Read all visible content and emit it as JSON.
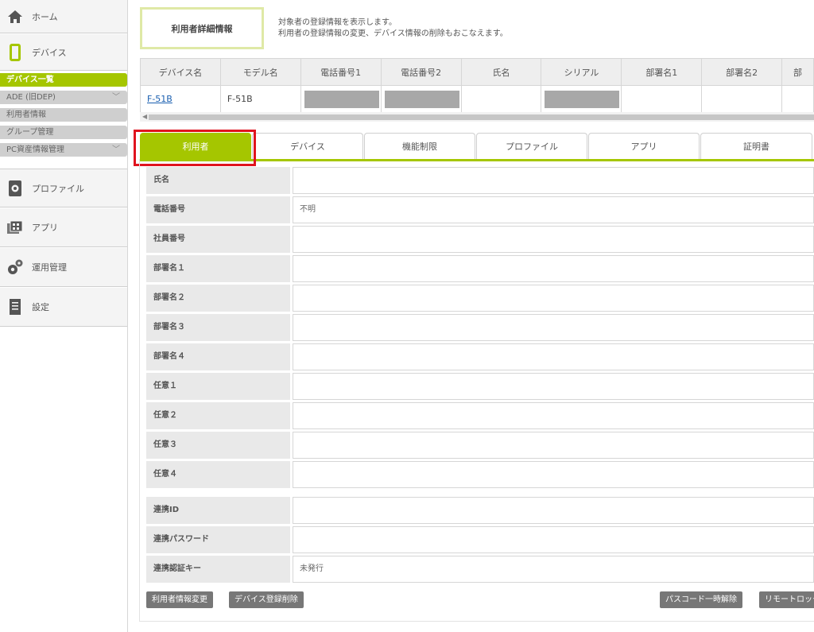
{
  "sidebar": {
    "home_label": "ホーム",
    "device_label": "デバイス",
    "sub_items": [
      {
        "label": "デバイス一覧",
        "active": true,
        "has_chevron": false
      },
      {
        "label": "ADE (旧DEP)",
        "active": false,
        "has_chevron": true
      },
      {
        "label": "利用者情報",
        "active": false,
        "has_chevron": false
      },
      {
        "label": "グループ管理",
        "active": false,
        "has_chevron": false
      },
      {
        "label": "PC資産情報管理",
        "active": false,
        "has_chevron": true
      }
    ],
    "profile_label": "プロファイル",
    "app_label": "アプリ",
    "ops_label": "運用管理",
    "settings_label": "設定"
  },
  "header": {
    "title": "利用者詳細情報",
    "desc_line1": "対象者の登録情報を表示します。",
    "desc_line2": "利用者の登録情報の変更、デバイス情報の削除もおこなえます。"
  },
  "device_table": {
    "columns": [
      "デバイス名",
      "モデル名",
      "電話番号1",
      "電話番号2",
      "氏名",
      "シリアル",
      "部署名1",
      "部署名2",
      "部"
    ],
    "row": {
      "device_name": "F-51B",
      "model_name": "F-51B",
      "masked_cells": [
        "電話番号1",
        "電話番号2",
        "シリアル"
      ]
    }
  },
  "tabs": [
    {
      "label": "利用者",
      "active": true
    },
    {
      "label": "デバイス",
      "active": false
    },
    {
      "label": "機能制限",
      "active": false
    },
    {
      "label": "プロファイル",
      "active": false
    },
    {
      "label": "アプリ",
      "active": false
    },
    {
      "label": "証明書",
      "active": false
    }
  ],
  "form": {
    "rows": [
      {
        "label": "氏名",
        "value": ""
      },
      {
        "label": "電話番号",
        "value": "不明"
      },
      {
        "label": "社員番号",
        "value": ""
      },
      {
        "label": "部署名１",
        "value": ""
      },
      {
        "label": "部署名２",
        "value": ""
      },
      {
        "label": "部署名３",
        "value": ""
      },
      {
        "label": "部署名４",
        "value": ""
      },
      {
        "label": "任意１",
        "value": ""
      },
      {
        "label": "任意２",
        "value": ""
      },
      {
        "label": "任意３",
        "value": ""
      },
      {
        "label": "任意４",
        "value": ""
      },
      {
        "label": "連携ID",
        "value": ""
      },
      {
        "label": "連携パスワード",
        "value": ""
      },
      {
        "label": "連携認証キー",
        "value": "未発行"
      }
    ]
  },
  "buttons": {
    "edit_user": "利用者情報変更",
    "delete_device": "デバイス登録削除",
    "passcode_unlock": "パスコード一時解除",
    "remote_lock": "リモートロック"
  },
  "colors": {
    "accent": "#a5c600",
    "highlight": "#e0141e"
  }
}
